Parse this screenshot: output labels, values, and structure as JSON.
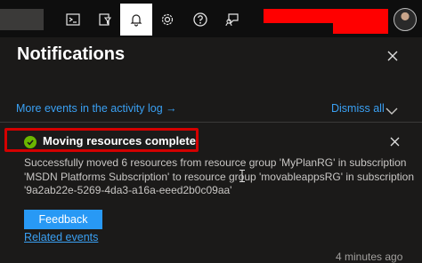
{
  "topbar": {
    "icons": [
      {
        "name": "cloud-shell-icon"
      },
      {
        "name": "directory-filter-icon"
      },
      {
        "name": "notifications-bell-icon"
      },
      {
        "name": "settings-gear-icon"
      },
      {
        "name": "help-question-icon"
      },
      {
        "name": "feedback-icon"
      }
    ]
  },
  "panel": {
    "title": "Notifications",
    "activity_link": "More events in the activity log →",
    "dismiss_all": "Dismiss all"
  },
  "notification": {
    "title": "Moving resources complete",
    "body": "Successfully moved 6 resources from resource group 'MyPlanRG' in subscription 'MSDN Platforms Subscription' to resource group 'movableappsRG' in subscription '9a2ab22e-5269-4da3-a16a-eeed2b0c09aa'",
    "feedback_label": "Feedback",
    "related_events": "Related events",
    "time": "4 minutes ago"
  },
  "colors": {
    "background": "#1b1a19",
    "link": "#3aa0f3",
    "primary_button": "#2899f5",
    "success": "#6bb700",
    "highlight_border": "#d40000",
    "redaction": "#ff0000"
  }
}
